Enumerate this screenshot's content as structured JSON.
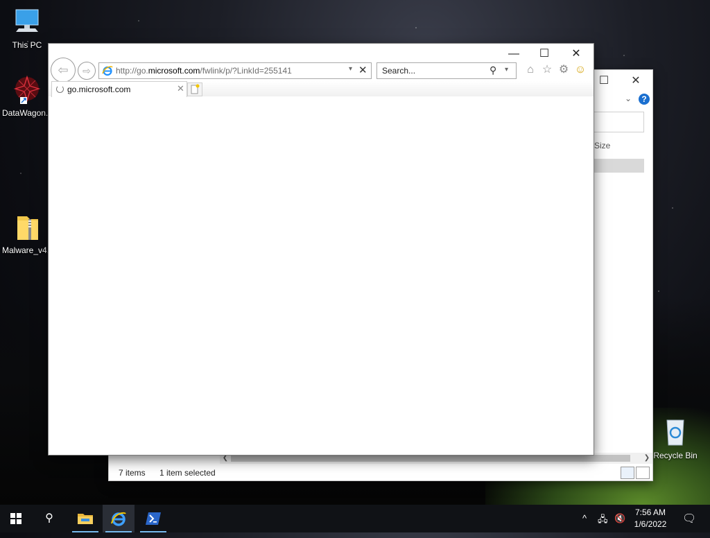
{
  "desktop": {
    "icons": [
      {
        "label": "This PC"
      },
      {
        "label": "DataWagon..."
      },
      {
        "label": "Malware_v4..."
      },
      {
        "label": "Recycle Bin"
      }
    ]
  },
  "explorer": {
    "column_header": "Size",
    "status": {
      "items": "7 items",
      "selected": "1 item selected"
    }
  },
  "ie": {
    "address": {
      "prefix": "http://go.",
      "domain": "microsoft.com",
      "path": "/fwlink/p/?LinkId=255141"
    },
    "search_placeholder": "Search...",
    "tab_title": "go.microsoft.com"
  },
  "taskbar": {
    "time": "7:56 AM",
    "date": "1/6/2022"
  },
  "colors": {
    "accent": "#1a6fd0",
    "taskbar": "#101216",
    "ie_blue": "#1e90ff"
  },
  "icons": [
    "windows-start-icon",
    "search-icon",
    "file-explorer-icon",
    "internet-explorer-icon",
    "powershell-icon",
    "home-icon",
    "favorites-star-icon",
    "settings-gear-icon",
    "smiley-feedback-icon"
  ]
}
